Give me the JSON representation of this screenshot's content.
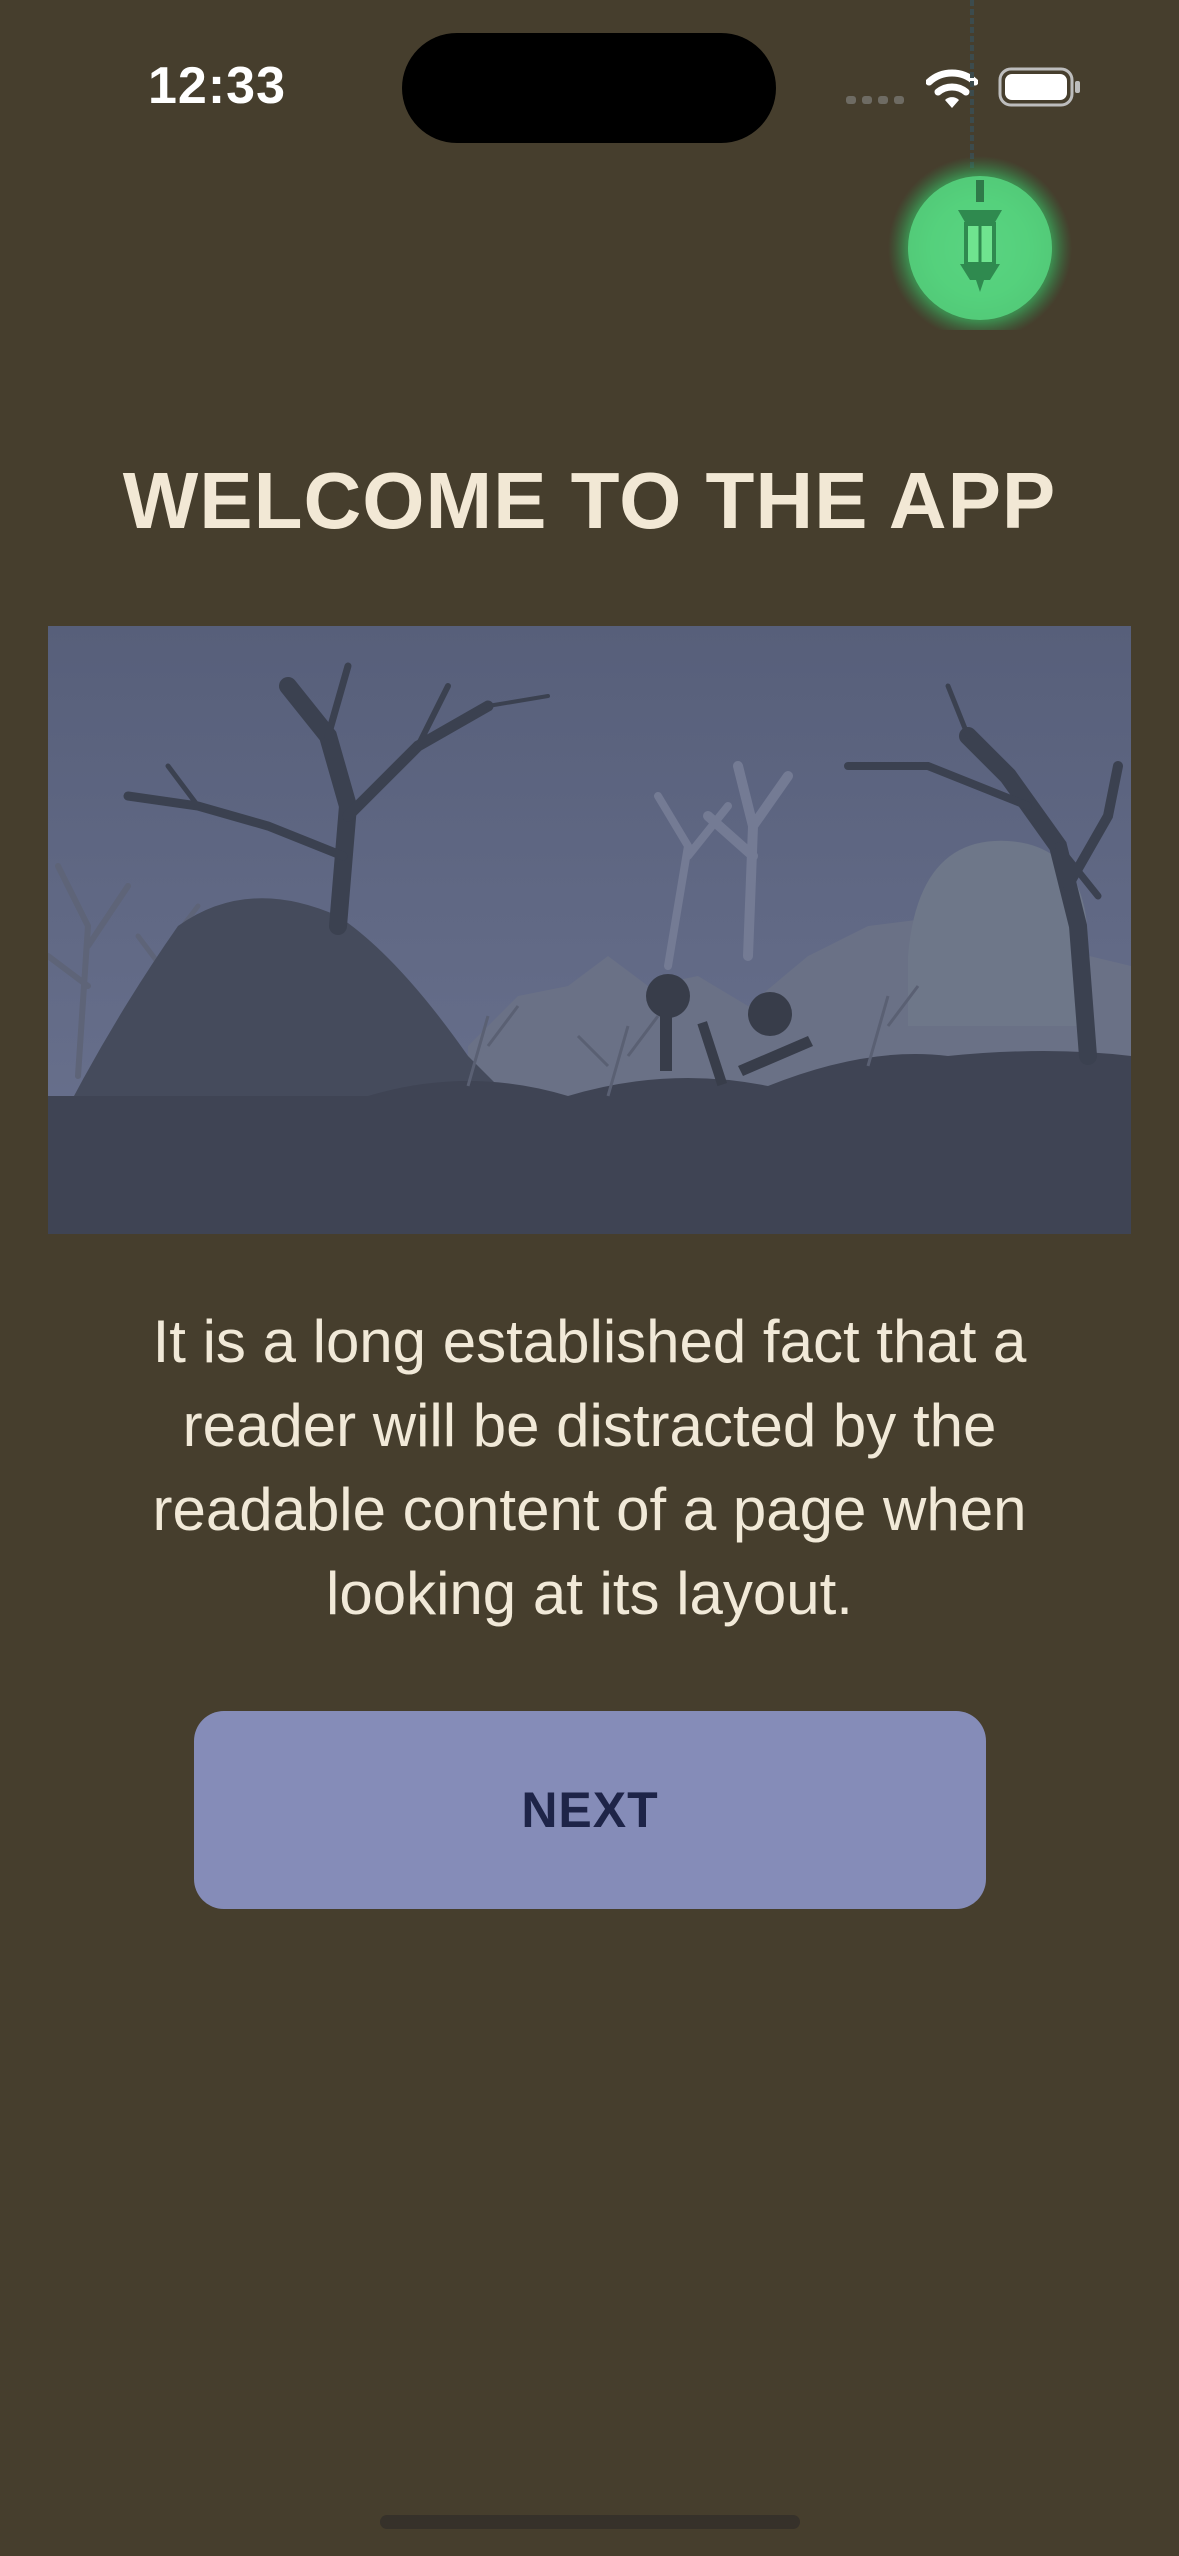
{
  "status_bar": {
    "time": "12:33",
    "icons": [
      "cellular-signal-icon",
      "wifi-icon",
      "battery-icon"
    ]
  },
  "lantern": {
    "icon": "lantern-icon",
    "glow_color": "#4fd37a"
  },
  "onboarding": {
    "title": "WELCOME TO THE APP",
    "hero_image": "graveyard-scene-illustration",
    "description": "It is a long established fact that a reader will be distracted by the readable content of a page when looking at its layout.",
    "next_label": "NEXT"
  },
  "colors": {
    "background": "#463e2d",
    "title": "#f2e8d5",
    "button_bg": "#858cb8",
    "button_text": "#1e2448"
  }
}
